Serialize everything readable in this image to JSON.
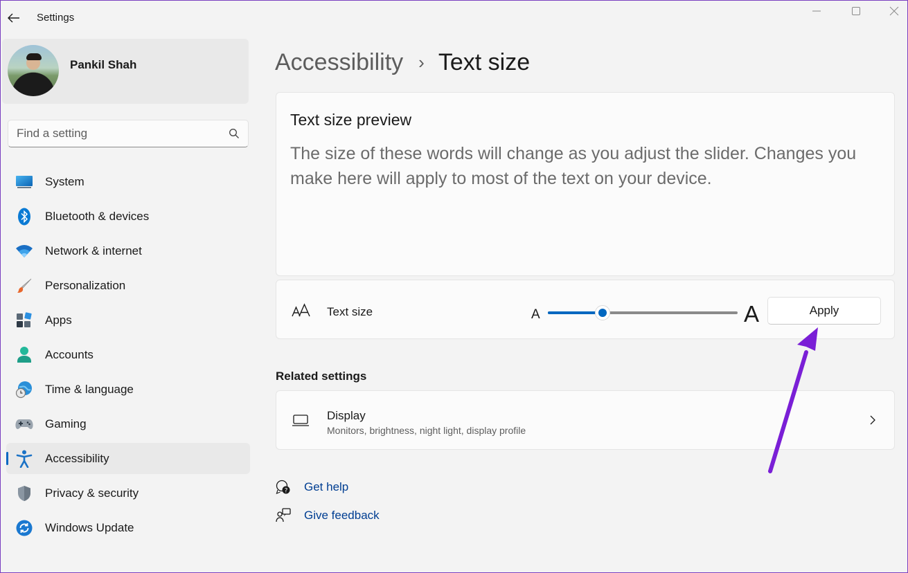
{
  "window": {
    "title": "Settings",
    "accent_color": "#0067c0",
    "controls": [
      "minimize-icon",
      "maximize-icon",
      "close-icon"
    ]
  },
  "profile": {
    "name": "Pankil Shah"
  },
  "search": {
    "placeholder": "Find a setting"
  },
  "sidebar": {
    "items": [
      {
        "label": "System",
        "icon": "system-icon"
      },
      {
        "label": "Bluetooth & devices",
        "icon": "bluetooth-icon"
      },
      {
        "label": "Network & internet",
        "icon": "wifi-icon"
      },
      {
        "label": "Personalization",
        "icon": "brush-icon"
      },
      {
        "label": "Apps",
        "icon": "apps-icon"
      },
      {
        "label": "Accounts",
        "icon": "accounts-icon"
      },
      {
        "label": "Time & language",
        "icon": "time-language-icon"
      },
      {
        "label": "Gaming",
        "icon": "gamepad-icon"
      },
      {
        "label": "Accessibility",
        "icon": "accessibility-icon",
        "active": true
      },
      {
        "label": "Privacy & security",
        "icon": "shield-icon"
      },
      {
        "label": "Windows Update",
        "icon": "windows-update-icon"
      }
    ]
  },
  "breadcrumb": {
    "parent": "Accessibility",
    "separator": "›",
    "current": "Text size"
  },
  "preview": {
    "title": "Text size preview",
    "text": "The size of these words will change as you adjust the slider. Changes you make here will apply to most of the text on your device."
  },
  "text_size": {
    "label": "Text size",
    "small_glyph": "A",
    "large_glyph": "A",
    "slider_fraction": 0.29,
    "apply_label": "Apply"
  },
  "related": {
    "heading": "Related settings",
    "display": {
      "title": "Display",
      "description": "Monitors, brightness, night light, display profile"
    }
  },
  "help": {
    "get_help": "Get help",
    "give_feedback": "Give feedback"
  },
  "annotation": {
    "arrow_color": "#7a1fd6"
  }
}
